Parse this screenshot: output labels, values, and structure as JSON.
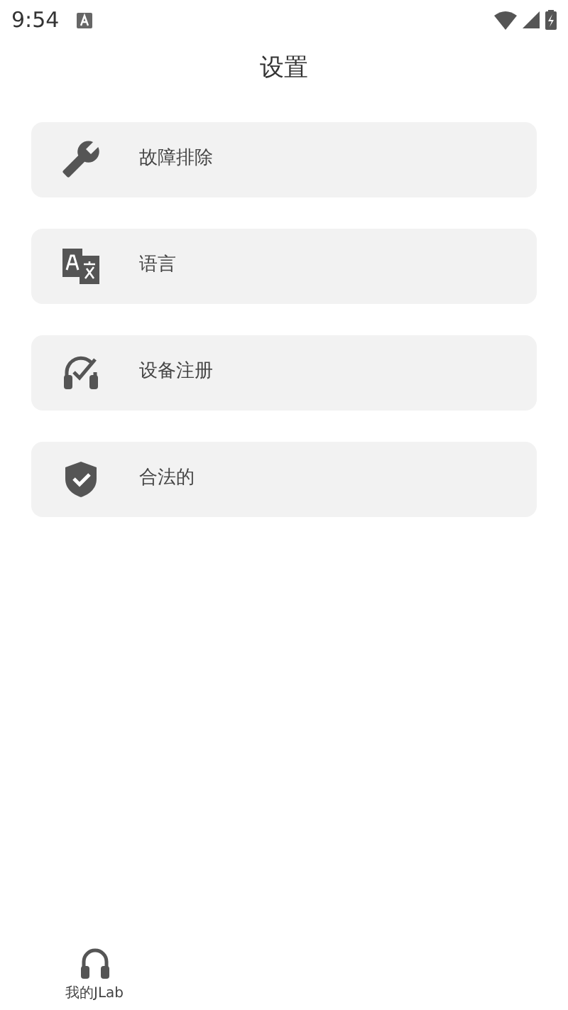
{
  "status_bar": {
    "time": "9:54"
  },
  "title": "设置",
  "items": [
    {
      "kind": "wrench",
      "label": "故障排除"
    },
    {
      "kind": "translate",
      "label": "语言"
    },
    {
      "kind": "headset",
      "label": "设备注册"
    },
    {
      "kind": "shield",
      "label": "合法的"
    }
  ],
  "bottom_nav": [
    {
      "label": "我的JLab"
    }
  ]
}
